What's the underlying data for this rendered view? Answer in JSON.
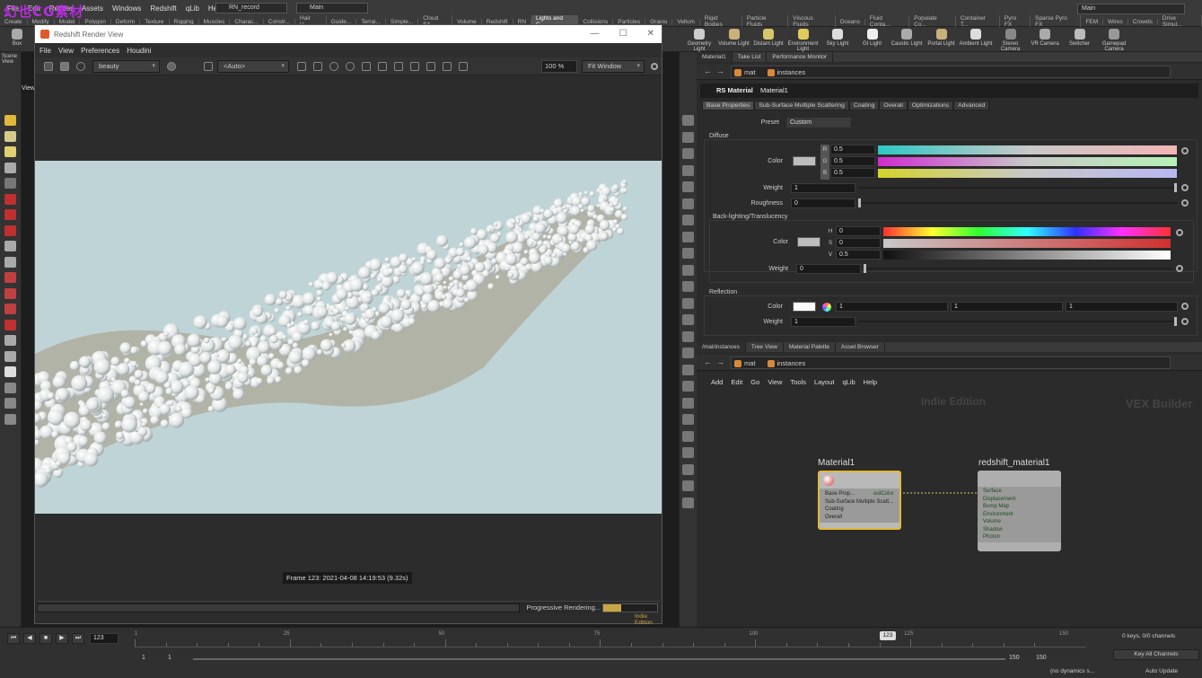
{
  "watermark": "幻也CG素材",
  "main_menu": [
    "File",
    "Edit",
    "Render",
    "Assets",
    "Windows",
    "Redshift",
    "qLib",
    "Help"
  ],
  "record_label": "RN_record",
  "desktop_main": "Main",
  "desktop_main_right": "Main",
  "shelf_tabs": [
    "Create",
    "Modify",
    "Model",
    "Polygon",
    "Deform",
    "Texture",
    "Rigging",
    "Muscles",
    "Charac...",
    "Constr...",
    "Hair U...",
    "Guide...",
    "Terrai...",
    "Simple...",
    "Cloud FX",
    "Volume",
    "Redshift",
    "RN",
    "Lights and C...",
    "Collisions",
    "Particles",
    "Grains",
    "Vellum",
    "Rigid Bodies",
    "Particle Fluids",
    "Viscous Fluids",
    "Oceans",
    "Fluid Conta...",
    "Populate Co...",
    "Container T...",
    "Pyro FX",
    "Sparse Pyro FX",
    "FEM",
    "Wires",
    "Crowds",
    "Drive Simul..."
  ],
  "shelf_tools": [
    "Geometry Light",
    "Volume Light",
    "Distant Light",
    "Environment Light",
    "Sky Light",
    "GI Light",
    "Caustic Light",
    "Portal Light",
    "Ambient Light",
    "Stereo Camera",
    "VR Camera",
    "Switcher",
    "Gamepad Camera"
  ],
  "left_labels": {
    "box": "Box",
    "scene_view": "Scene View",
    "view": "View"
  },
  "render_view": {
    "title": "Redshift Render View",
    "menu": [
      "File",
      "View",
      "Preferences",
      "Houdini"
    ],
    "aov": "beauty",
    "region": "<Auto>",
    "zoom": "100 %",
    "fit": "Fit Window",
    "frame_label": "Frame 123: 2021-04-08 14:19:53 (9.32s)",
    "progress_text": "Progressive Rendering...",
    "progress_pct": "33%",
    "progress_value": 0.33,
    "indie_edition": "Indie Edition"
  },
  "param_panel": {
    "tabs": [
      "Material1",
      "Take List",
      "Performance Monitor"
    ],
    "path": [
      "mat",
      "instances"
    ],
    "node_type": "RS Material",
    "node_name": "Material1",
    "subtabs": [
      "Base Properties",
      "Sub-Surface Multiple Scattering",
      "Coating",
      "Overall",
      "Optimizations",
      "Advanced"
    ],
    "preset_label": "Preset",
    "preset_value": "Custom",
    "diffuse": {
      "section": "Diffuse",
      "color_label": "Color",
      "r": "0.5",
      "g": "0.5",
      "b": "0.5",
      "rgb_labels": [
        "R",
        "G",
        "B"
      ],
      "weight_label": "Weight",
      "weight": "1",
      "roughness_label": "Roughness",
      "roughness": "0"
    },
    "backlighting": {
      "section": "Back-lighting/Translucency",
      "color_label": "Color",
      "h": "0",
      "s": "0",
      "v": "0.5",
      "hsv_labels": [
        "H",
        "S",
        "V"
      ],
      "weight_label": "Weight",
      "weight": "0"
    },
    "reflection": {
      "section": "Reflection",
      "color_label": "Color",
      "c1": "1",
      "c2": "1",
      "c3": "1",
      "weight_label": "Weight",
      "weight": "1"
    }
  },
  "network_panel": {
    "tabs": [
      "/mat/instances",
      "Tree View",
      "Material Palette",
      "Asset Browser"
    ],
    "path": [
      "mat",
      "instances"
    ],
    "menu": [
      "Add",
      "Edit",
      "Go",
      "View",
      "Tools",
      "Layout",
      "qLib",
      "Help"
    ],
    "watermark_indie": "Indie Edition",
    "watermark_vex": "VEX Builder",
    "node1": {
      "title": "Material1",
      "inputs": [
        "Base Prop...",
        "Sub-Surface Multiple Scatt...",
        "Coating",
        "Overall"
      ],
      "output": "outColor"
    },
    "node2": {
      "title": "redshift_material1",
      "inputs": [
        "Surface",
        "Displacement",
        "Bump Map",
        "Environment",
        "Volume",
        "Shadow",
        "Photon"
      ]
    }
  },
  "timeline": {
    "current_frame": "123",
    "ticks": [
      "1",
      "25",
      "50",
      "75",
      "100",
      "125",
      "150"
    ],
    "start": "1",
    "start2": "1",
    "end": "150",
    "end2": "150",
    "keys": "0 keys, 0/0 channels",
    "key_all": "Key All Channels",
    "dynamics": "(no dynamics s...",
    "auto_update": "Auto Update"
  },
  "colors": {
    "accent": "#e0b83a",
    "progress": "#c9a545",
    "render_bg": "#bfd4d7"
  }
}
